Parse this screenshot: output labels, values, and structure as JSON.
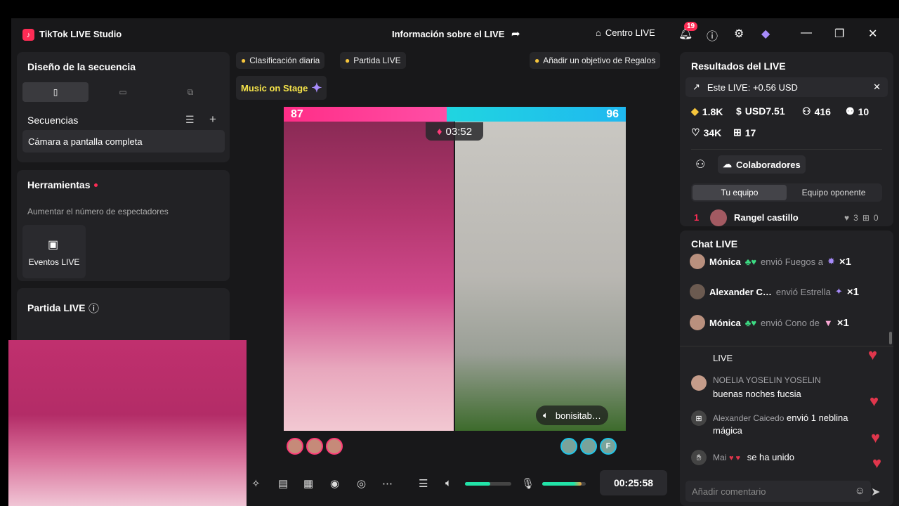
{
  "app": {
    "title": "TikTok LIVE Studio",
    "center_title": "Información sobre el LIVE",
    "centro": "Centro LIVE",
    "notif_count": "19"
  },
  "left": {
    "scene_title": "Diseño de la secuencia",
    "sequences_title": "Secuencias",
    "sequence_item": "Cámara a pantalla completa",
    "tools_title": "Herramientas",
    "tools_desc": "Aumentar el número de espectadores",
    "events_label": "Eventos LIVE",
    "match_title": "Partida LIVE"
  },
  "top": {
    "ranking": "Clasificación diaria",
    "match": "Partida LIVE",
    "goal": "Añadir un objetivo de Regalos",
    "music": "Music on Stage"
  },
  "battle": {
    "score_left": "87",
    "score_right": "96",
    "timer": "03:52",
    "streamer": "bonisitab…"
  },
  "controls": {
    "time": "00:25:58",
    "volume": 0.55,
    "mic": 0.9
  },
  "right": {
    "results_title": "Resultados del LIVE",
    "earnings": "Este LIVE: +0.56 USD",
    "stats": {
      "diamonds": "1.8K",
      "usd": "USD7.51",
      "viewers": "416",
      "new_followers": "10",
      "likes": "34K",
      "gifters": "17"
    },
    "collab": "Colaboradores",
    "tab_team": "Tu equipo",
    "tab_opponent": "Equipo oponente",
    "top_rank": "1",
    "top_name": "Rangel castillo",
    "top_hearts": "3",
    "top_gifts": "0",
    "chat_title": "Chat LIVE",
    "gifts": [
      {
        "name": "Mónica",
        "text": "envió Fuegos a",
        "count": "×1"
      },
      {
        "name": "Alexander C…",
        "text": "envió Estrella",
        "count": "×1"
      },
      {
        "name": "Mónica",
        "text": "envió Cono de",
        "count": "×1"
      }
    ],
    "messages": [
      {
        "name": "",
        "text": "LIVE"
      },
      {
        "name": "NOELIA YOSELIN YOSELIN",
        "text": "buenas noches fucsia"
      },
      {
        "name": "Alexander Caicedo",
        "text": "envió 1 neblina mágica"
      },
      {
        "name": "Mai",
        "text": "se ha unido"
      }
    ],
    "comment_placeholder": "Añadir comentario"
  }
}
